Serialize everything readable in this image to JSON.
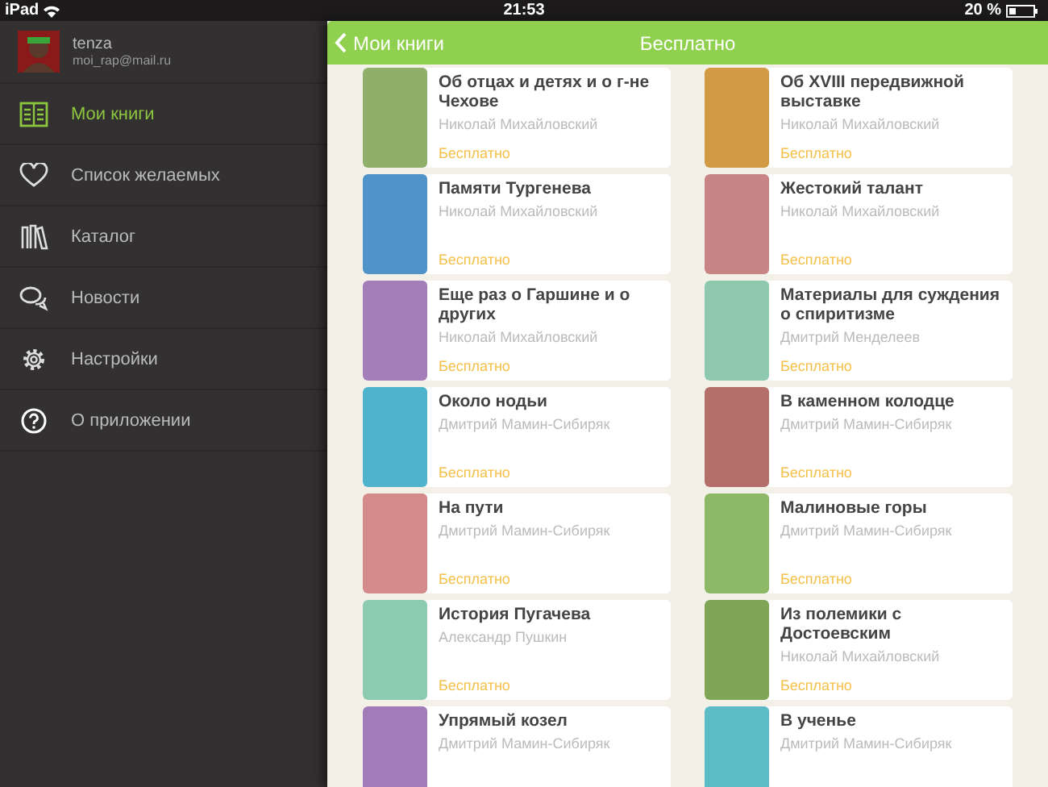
{
  "status_bar": {
    "device": "iPad",
    "time": "21:53",
    "battery": "20 %"
  },
  "profile": {
    "name": "tenza",
    "email": "moi_rap@mail.ru"
  },
  "sidebar": {
    "items": [
      {
        "label": "Мои книги",
        "selected": true
      },
      {
        "label": "Список желаемых",
        "selected": false
      },
      {
        "label": "Каталог",
        "selected": false
      },
      {
        "label": "Новости",
        "selected": false
      },
      {
        "label": "Настройки",
        "selected": false
      },
      {
        "label": "О приложении",
        "selected": false
      }
    ]
  },
  "nav_bar": {
    "back": "Мои книги",
    "title": "Бесплатно"
  },
  "books": [
    {
      "title": "Об отцах и детях и о г-не Чехове",
      "author": "Николай Михайловский",
      "price": "Бесплатно",
      "color": "#8fb06a"
    },
    {
      "title": "Об XVIII передвижной выставке",
      "author": "Николай Михайловский",
      "price": "Бесплатно",
      "color": "#d39a45"
    },
    {
      "title": "Памяти Тургенева",
      "author": "Николай Михайловский",
      "price": "Бесплатно",
      "color": "#4f93c8"
    },
    {
      "title": "Жестокий талант",
      "author": "Николай Михайловский",
      "price": "Бесплатно",
      "color": "#c98585"
    },
    {
      "title": "Еще раз о Гаршине и о других",
      "author": "Николай Михайловский",
      "price": "Бесплатно",
      "color": "#a47eb8"
    },
    {
      "title": "Материалы для суждения о спиритизме",
      "author": "Дмитрий Менделеев",
      "price": "Бесплатно",
      "color": "#8ec9ad"
    },
    {
      "title": "Около нодьи",
      "author": "Дмитрий Мамин-Сибиряк",
      "price": "Бесплатно",
      "color": "#4fb3cc"
    },
    {
      "title": "В каменном колодце",
      "author": "Дмитрий Мамин-Сибиряк",
      "price": "Бесплатно",
      "color": "#b56f6a"
    },
    {
      "title": "На пути",
      "author": "Дмитрий Мамин-Сибиряк",
      "price": "Бесплатно",
      "color": "#d48a8a"
    },
    {
      "title": "Малиновые горы",
      "author": "Дмитрий Мамин-Сибиряк",
      "price": "Бесплатно",
      "color": "#8db866"
    },
    {
      "title": "История Пугачева",
      "author": "Александр Пушкин",
      "price": "Бесплатно",
      "color": "#8ccbb0"
    },
    {
      "title": "Из полемики с Достоевским",
      "author": "Николай Михайловский",
      "price": "Бесплатно",
      "color": "#7ea656"
    },
    {
      "title": "Упрямый козел",
      "author": "Дмитрий Мамин-Сибиряк",
      "color": "#a27cb8"
    },
    {
      "title": "В ученье",
      "author": "Дмитрий Мамин-Сибиряк",
      "color": "#5bbcc6"
    }
  ]
}
